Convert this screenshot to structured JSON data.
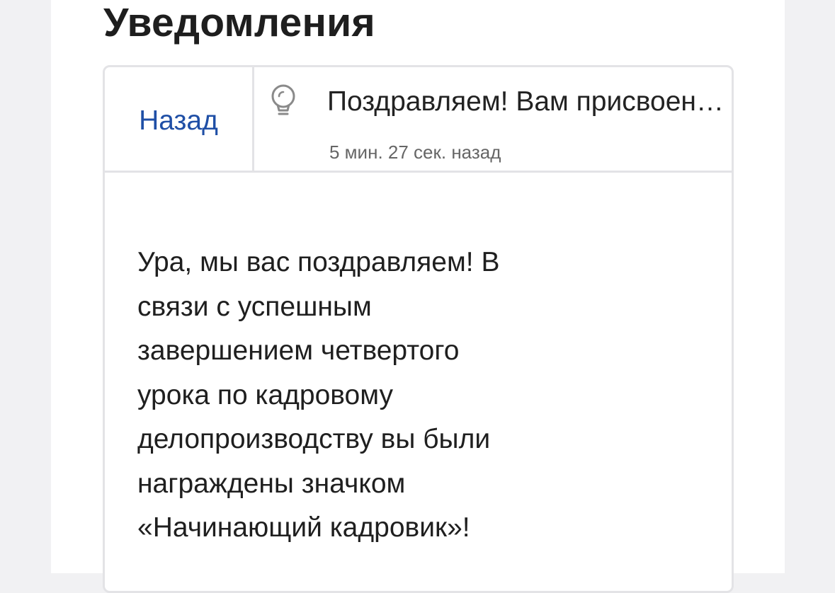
{
  "header": {
    "title": "Уведомления"
  },
  "notification": {
    "back_label": "Назад",
    "icon": "lightbulb-icon",
    "title": "Поздравляем! Вам присвоен значок",
    "time_ago": "5 мин. 27 сек. назад",
    "message_lines": [
      "Ура, мы вас поздравляем! В",
      "связи с успешным",
      "завершением четвертого",
      "урока по кадровому",
      "делопроизводству вы были",
      "награждены значком",
      "«Начинающий кадровик»!"
    ]
  },
  "colors": {
    "link": "#1f4fa6",
    "border": "#e3e3e6",
    "background": "#f1f1f3",
    "surface": "#ffffff"
  }
}
